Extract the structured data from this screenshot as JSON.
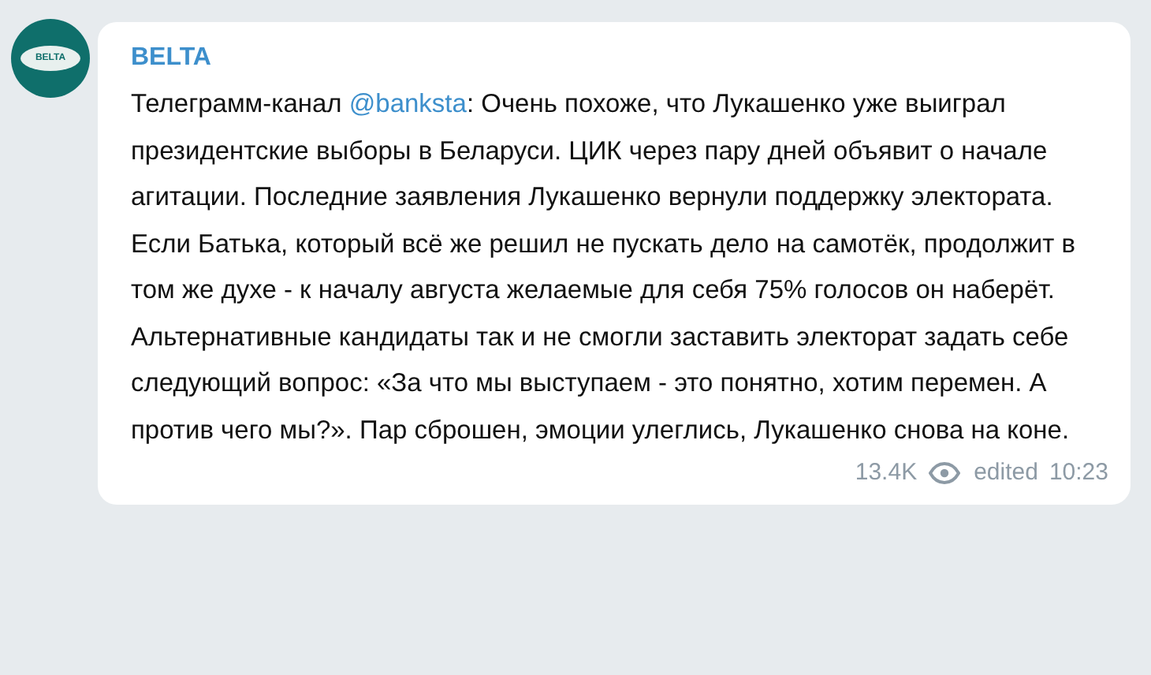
{
  "message": {
    "avatar_text": "BELTA",
    "sender": "BELTA",
    "paragraphs": [
      {
        "before": "Телеграмм-канал ",
        "link": "@banksta",
        "after": ": Очень похоже, что Лукашенко уже выиграл президентские выборы в Беларуси. ЦИК через пару дней объявит о начале агитации. Последние заявления Лукашенко вернули поддержку электората. Если Батька, который всё же решил не пускать дело на самотёк, продолжит в том же духе - к началу августа желаемые для себя 75% голосов он наберёт."
      },
      {
        "before": "Альтернативные кандидаты так и не смогли заставить электорат задать себе следующий вопрос: «За что мы выступаем - это понятно, хотим перемен. А против чего мы?». Пар сброшен, эмоции улеглись, Лукашенко снова на коне."
      }
    ],
    "views": "13.4K",
    "edited": "edited",
    "time": "10:23"
  }
}
